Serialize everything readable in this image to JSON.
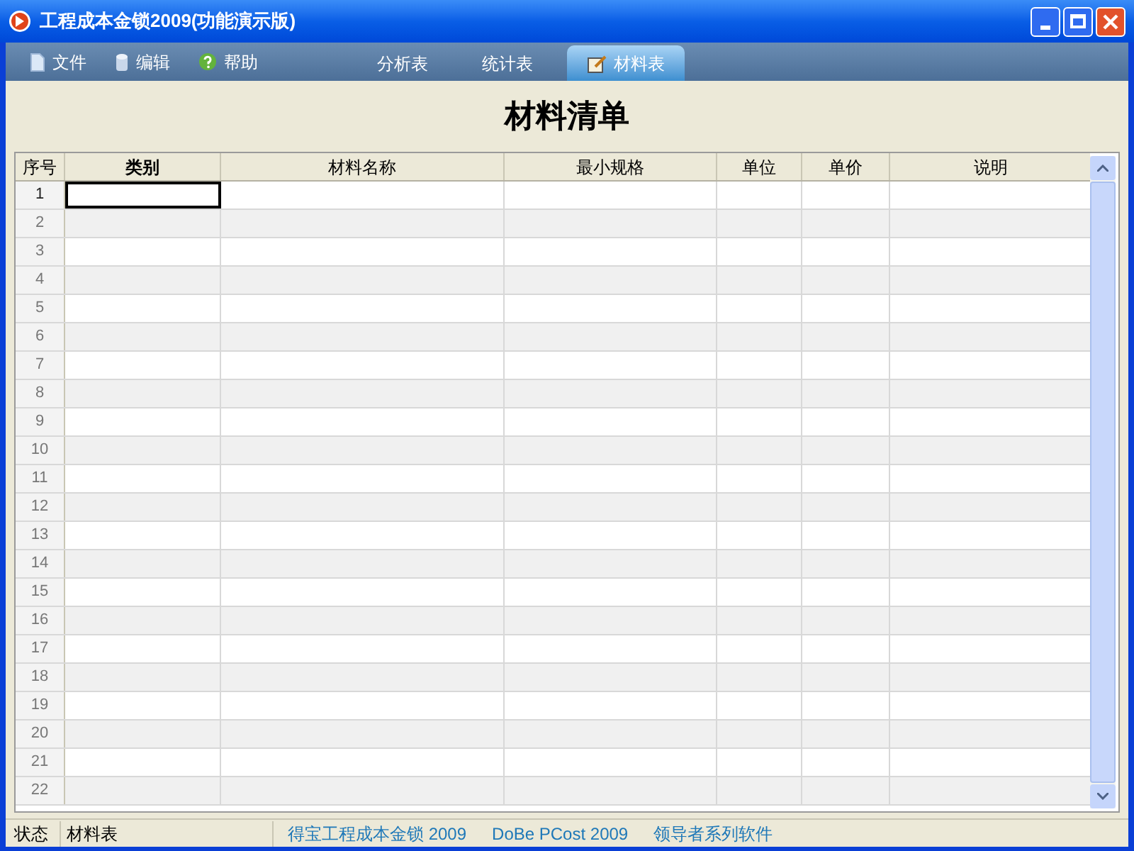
{
  "window": {
    "title": "工程成本金锁2009(功能演示版)"
  },
  "menu": [
    {
      "label": "文件",
      "kind": "file"
    },
    {
      "label": "编辑",
      "kind": "edit"
    },
    {
      "label": "帮助",
      "kind": "help"
    }
  ],
  "tabs": [
    {
      "label": "分析表",
      "selected": false
    },
    {
      "label": "统计表",
      "selected": false
    },
    {
      "label": "材料表",
      "selected": true
    }
  ],
  "heading": "材料清单",
  "table": {
    "columns": [
      {
        "label": "序号",
        "selected": false
      },
      {
        "label": "类别",
        "selected": true
      },
      {
        "label": "材料名称",
        "selected": false
      },
      {
        "label": "最小规格",
        "selected": false
      },
      {
        "label": "单位",
        "selected": false
      },
      {
        "label": "单价",
        "selected": false
      },
      {
        "label": "说明",
        "selected": false
      }
    ],
    "rows": [
      {
        "number": "1",
        "selected": true
      },
      {
        "number": "2",
        "selected": false
      },
      {
        "number": "3",
        "selected": false
      },
      {
        "number": "4",
        "selected": false
      },
      {
        "number": "5",
        "selected": false
      },
      {
        "number": "6",
        "selected": false
      },
      {
        "number": "7",
        "selected": false
      },
      {
        "number": "8",
        "selected": false
      },
      {
        "number": "9",
        "selected": false
      },
      {
        "number": "10",
        "selected": false
      },
      {
        "number": "11",
        "selected": false
      },
      {
        "number": "12",
        "selected": false
      },
      {
        "number": "13",
        "selected": false
      },
      {
        "number": "14",
        "selected": false
      },
      {
        "number": "15",
        "selected": false
      },
      {
        "number": "16",
        "selected": false
      },
      {
        "number": "17",
        "selected": false
      },
      {
        "number": "18",
        "selected": false
      },
      {
        "number": "19",
        "selected": false
      },
      {
        "number": "20",
        "selected": false
      },
      {
        "number": "21",
        "selected": false
      },
      {
        "number": "22",
        "selected": false
      }
    ]
  },
  "status_bar": {
    "label": "状态",
    "value": "材料表",
    "info": [
      "得宝工程成本金锁 2009",
      "DoBe PCost 2009",
      "领导者系列软件"
    ]
  }
}
